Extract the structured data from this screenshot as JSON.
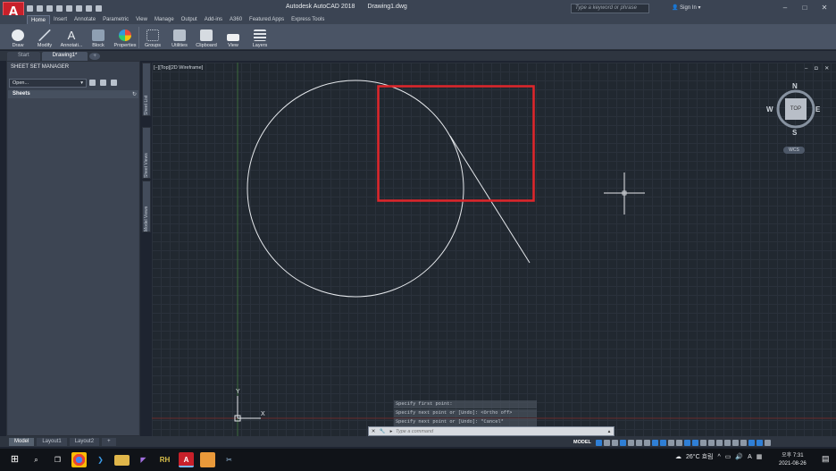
{
  "app": {
    "logo_letter": "A",
    "title": "Autodesk AutoCAD 2018",
    "file": "Drawing1.dwg",
    "search_placeholder": "Type a keyword or phrase",
    "signin": "Sign In"
  },
  "ribbon_tabs": [
    "Home",
    "Insert",
    "Annotate",
    "Parametric",
    "View",
    "Manage",
    "Output",
    "Add-ins",
    "A360",
    "Featured Apps",
    "Express Tools"
  ],
  "ribbon_groups": [
    "Draw",
    "Modify",
    "Annotati...",
    "Block",
    "Properties",
    "Groups",
    "Utilities",
    "Clipboard",
    "View",
    "Layers"
  ],
  "doc_tabs": [
    "Start",
    "Drawing1*"
  ],
  "sheet_set": {
    "title": "SHEET SET MANAGER",
    "open_label": "Open...",
    "sheets_header": "Sheets",
    "side_tabs": [
      "Sheet List",
      "Sheet Views",
      "Model Views"
    ]
  },
  "viewport": {
    "label": "[−][Top][2D Wireframe]",
    "controls": "– ◘ ✕"
  },
  "navcube": {
    "n": "N",
    "s": "S",
    "e": "E",
    "w": "W",
    "face": "TOP",
    "wcs": "WCS"
  },
  "ucs": {
    "x": "X",
    "y": "Y"
  },
  "command_history": [
    "Specify first point:",
    "Specify next point or [Undo]: <Ortho off>",
    "Specify next point or [Undo]: *Cancel*"
  ],
  "command_placeholder": "Type a command",
  "layout_tabs": [
    "Model",
    "Layout1",
    "Layout2"
  ],
  "status": {
    "model": "MODEL"
  },
  "tray": {
    "weather": "26°C  흐림",
    "ime": "A",
    "time": "오후 7:31",
    "date": "2021-08-26"
  },
  "colors": {
    "accent_red": "#e0262b",
    "title_bg": "#3b4453",
    "canvas_bg": "#212830"
  }
}
